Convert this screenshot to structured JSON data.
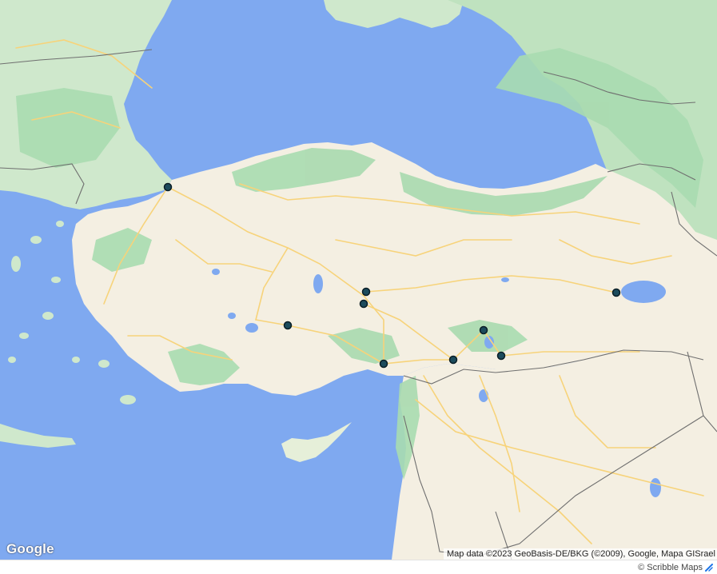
{
  "map": {
    "colors": {
      "water": "#7fa9f0",
      "land": "#f6f3ec",
      "forest": "#a9dbb0",
      "roads": "#f7d37a",
      "borders": "#6f6f6f",
      "marker_fill": "#1c4b5c",
      "marker_stroke": "#0b1e26"
    },
    "markers": [
      {
        "name": "marker-istanbul"
      },
      {
        "name": "marker-kirsehir-north"
      },
      {
        "name": "marker-kirsehir-south"
      },
      {
        "name": "marker-konya"
      },
      {
        "name": "marker-adana"
      },
      {
        "name": "marker-gaziantep"
      },
      {
        "name": "marker-adiyaman"
      },
      {
        "name": "marker-sanliurfa"
      },
      {
        "name": "marker-van"
      }
    ]
  },
  "attribution": {
    "logo": "Google",
    "map_data": "Map data ©2023 GeoBasis-DE/BKG (©2009), Google, Mapa GISrael"
  },
  "footer": {
    "credit": "© Scribble Maps",
    "credit_icon": "scribble-maps-icon"
  }
}
